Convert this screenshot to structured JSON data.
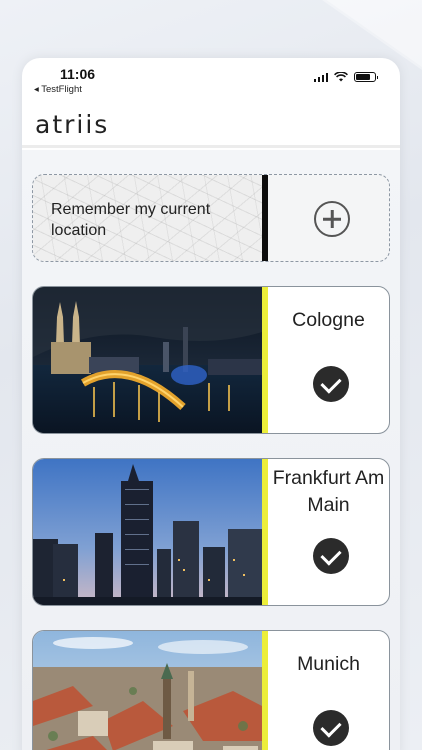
{
  "status_bar": {
    "time": "11:06",
    "back_app": "◂ TestFlight"
  },
  "header": {
    "logo": "atriis"
  },
  "location_card": {
    "text": "Remember my current location",
    "add_icon": "plus-circle-icon"
  },
  "cities": [
    {
      "name": "Cologne",
      "selected": true
    },
    {
      "name": "Frankfurt Am Main",
      "selected": true
    },
    {
      "name": "Munich",
      "selected": true
    }
  ],
  "colors": {
    "accent": "#ecee3a",
    "check_bg": "#2b2b2b",
    "divider": "#0d0d0d"
  }
}
